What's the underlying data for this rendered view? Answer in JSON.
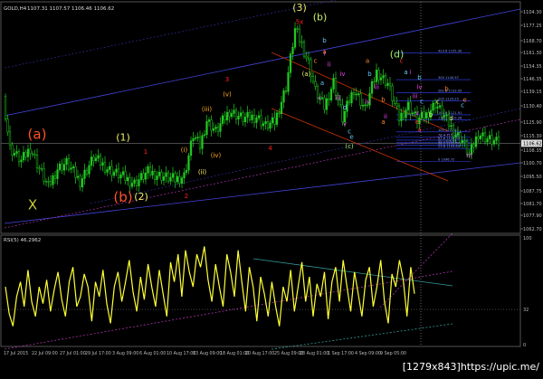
{
  "header": {
    "symbol": "GOLD,H4",
    "ohlc": "1107.31 1107.57 1106.46 1106.62",
    "rsi_title": "RSI(5) 46.2962"
  },
  "watermark": "[1279x843]https://upic.me/",
  "colors": {
    "background": "#000000",
    "axis": "#bbbbbb",
    "bull_candle": "#22cc22",
    "rsi_line": "#ffff33",
    "channel_blue": "#4444dd",
    "channel_red": "#cc3300",
    "dotted_magenta": "#aa33aa",
    "dotted_teal": "#339999"
  },
  "chart_data": [
    {
      "type": "candlestick",
      "title": "GOLD,H4",
      "y_ticks": [
        "1104.30",
        "1177.25",
        "1168.70",
        "1161.30",
        "1154.35",
        "1146.35",
        "1139.15",
        "1130.40",
        "1125.90",
        "1115.30",
        "1108.35",
        "1100.70",
        "1095.50",
        "1087.75",
        "1081.70",
        "1077.90",
        "1062.70"
      ],
      "x_ticks": [
        "17 Jul 2015",
        "22 Jul 09:00",
        "27 Jul 01:00",
        "29 Jul 17:00",
        "3 Aug 09:00",
        "6 Aug 01:00",
        "10 Aug 17:00",
        "13 Aug 09:00",
        "18 Aug 01:00",
        "20 Aug 17:00",
        "25 Aug 09:00",
        "28 Aug 01:00",
        "1 Sep 17:00",
        "4 Sep 09:00",
        "9 Sep 05:00"
      ],
      "price_label": "1106.62",
      "close_path": [
        {
          "x": 0,
          "y": 1132
        },
        {
          "x": 3,
          "y": 1104
        },
        {
          "x": 8,
          "y": 1097
        },
        {
          "x": 12,
          "y": 1104
        },
        {
          "x": 16,
          "y": 1093
        },
        {
          "x": 20,
          "y": 1083
        },
        {
          "x": 24,
          "y": 1093
        },
        {
          "x": 28,
          "y": 1096
        },
        {
          "x": 34,
          "y": 1086
        },
        {
          "x": 40,
          "y": 1099
        },
        {
          "x": 46,
          "y": 1093
        },
        {
          "x": 52,
          "y": 1089
        },
        {
          "x": 58,
          "y": 1085
        },
        {
          "x": 64,
          "y": 1091
        },
        {
          "x": 70,
          "y": 1089
        },
        {
          "x": 76,
          "y": 1087
        },
        {
          "x": 80,
          "y": 1089
        },
        {
          "x": 84,
          "y": 1111
        },
        {
          "x": 87,
          "y": 1105
        },
        {
          "x": 90,
          "y": 1119
        },
        {
          "x": 94,
          "y": 1113
        },
        {
          "x": 100,
          "y": 1124
        },
        {
          "x": 106,
          "y": 1120
        },
        {
          "x": 112,
          "y": 1121
        },
        {
          "x": 116,
          "y": 1116
        },
        {
          "x": 120,
          "y": 1118
        },
        {
          "x": 125,
          "y": 1137
        },
        {
          "x": 129,
          "y": 1168
        },
        {
          "x": 132,
          "y": 1160
        },
        {
          "x": 135,
          "y": 1150
        },
        {
          "x": 138,
          "y": 1135
        },
        {
          "x": 142,
          "y": 1126
        },
        {
          "x": 146,
          "y": 1140
        },
        {
          "x": 150,
          "y": 1120
        },
        {
          "x": 155,
          "y": 1136
        },
        {
          "x": 160,
          "y": 1125
        },
        {
          "x": 165,
          "y": 1145
        },
        {
          "x": 170,
          "y": 1139
        },
        {
          "x": 175,
          "y": 1120
        },
        {
          "x": 179,
          "y": 1127
        },
        {
          "x": 183,
          "y": 1119
        },
        {
          "x": 187,
          "y": 1122
        },
        {
          "x": 191,
          "y": 1128
        },
        {
          "x": 195,
          "y": 1121
        },
        {
          "x": 199,
          "y": 1113
        },
        {
          "x": 203,
          "y": 1108
        },
        {
          "x": 206,
          "y": 1100
        },
        {
          "x": 210,
          "y": 1112
        },
        {
          "x": 214,
          "y": 1109
        },
        {
          "x": 218,
          "y": 1107
        }
      ],
      "wave_labels": [
        {
          "text": "X",
          "color": "#cccc33",
          "x": 12,
          "y": 1071,
          "size": "large"
        },
        {
          "text": "(a)",
          "color": "#ff5522",
          "x": 14,
          "y": 1109,
          "size": "large"
        },
        {
          "text": "(1)",
          "color": "#eeee66",
          "x": 52,
          "y": 1108,
          "size": "medium"
        },
        {
          "text": "1",
          "color": "#ff2222",
          "x": 62,
          "y": 1101,
          "size": "small"
        },
        {
          "text": "(b)",
          "color": "#ff5522",
          "x": 52,
          "y": 1075,
          "size": "large"
        },
        {
          "text": "(2)",
          "color": "#eeee66",
          "x": 60,
          "y": 1076,
          "size": "medium"
        },
        {
          "text": "2",
          "color": "#ff2222",
          "x": 80,
          "y": 1077,
          "size": "small"
        },
        {
          "text": "(i)",
          "color": "#ffaa22",
          "x": 79,
          "y": 1102,
          "size": "small"
        },
        {
          "text": "(ii)",
          "color": "#ffee66",
          "x": 87,
          "y": 1090,
          "size": "small"
        },
        {
          "text": "(iii)",
          "color": "#ffaa22",
          "x": 89,
          "y": 1124,
          "size": "small"
        },
        {
          "text": "(iv)",
          "color": "#ffaa22",
          "x": 93,
          "y": 1099,
          "size": "small"
        },
        {
          "text": "(v)",
          "color": "#ffaa22",
          "x": 98,
          "y": 1132,
          "size": "small"
        },
        {
          "text": "3",
          "color": "#ff2222",
          "x": 98,
          "y": 1140,
          "size": "small"
        },
        {
          "text": "4",
          "color": "#ff2222",
          "x": 117,
          "y": 1103,
          "size": "small"
        },
        {
          "text": "(3)",
          "color": "#eeee66",
          "x": 130,
          "y": 1178,
          "size": "medium"
        },
        {
          "text": "5x",
          "color": "#ff2222",
          "x": 130,
          "y": 1171,
          "size": "small"
        },
        {
          "text": "(b)",
          "color": "#ccee66",
          "x": 139,
          "y": 1173,
          "size": "medium"
        },
        {
          "text": "b",
          "color": "#66ccff",
          "x": 141,
          "y": 1161,
          "size": "small"
        },
        {
          "text": "a",
          "color": "#ff8833",
          "x": 141,
          "y": 1155,
          "size": "small"
        },
        {
          "text": "i",
          "color": "#ee44ee",
          "x": 141,
          "y": 1154,
          "size": "small"
        },
        {
          "text": "c",
          "color": "#ff8833",
          "x": 137,
          "y": 1150,
          "size": "small"
        },
        {
          "text": "ii",
          "color": "#ee44ee",
          "x": 143,
          "y": 1148,
          "size": "small"
        },
        {
          "text": "(a)",
          "color": "#eeee66",
          "x": 133,
          "y": 1143,
          "size": "small"
        },
        {
          "text": "iv",
          "color": "#ee44ee",
          "x": 149,
          "y": 1143,
          "size": "small"
        },
        {
          "text": "a",
          "color": "#66ccff",
          "x": 140,
          "y": 1138,
          "size": "small"
        },
        {
          "text": "c",
          "color": "#ee44ee",
          "x": 139,
          "y": 1130,
          "size": "small"
        },
        {
          "text": "iii",
          "color": "#ee44ee",
          "x": 147,
          "y": 1130,
          "size": "small"
        },
        {
          "text": "d",
          "color": "#66ccff",
          "x": 150,
          "y": 1125,
          "size": "small"
        },
        {
          "text": "v",
          "color": "#ee44ee",
          "x": 150,
          "y": 1116,
          "size": "small"
        },
        {
          "text": "c",
          "color": "#66ccff",
          "x": 152,
          "y": 1112,
          "size": "small"
        },
        {
          "text": "e",
          "color": "#66ccff",
          "x": 153,
          "y": 1109,
          "size": "small"
        },
        {
          "text": "(c)",
          "color": "#99ee66",
          "x": 152,
          "y": 1104,
          "size": "small"
        },
        {
          "text": "a",
          "color": "#ff8833",
          "x": 160,
          "y": 1150,
          "size": "small"
        },
        {
          "text": "b",
          "color": "#66ccff",
          "x": 161,
          "y": 1143,
          "size": "small"
        },
        {
          "text": "iii",
          "color": "#ee44ee",
          "x": 164,
          "y": 1136,
          "size": "small"
        },
        {
          "text": "iv",
          "color": "#ee44ee",
          "x": 160,
          "y": 1128,
          "size": "small"
        },
        {
          "text": "b",
          "color": "#ff8833",
          "x": 167,
          "y": 1129,
          "size": "small"
        },
        {
          "text": "ii",
          "color": "#ee44ee",
          "x": 168,
          "y": 1120,
          "size": "small"
        },
        {
          "text": "a",
          "color": "#ff8833",
          "x": 167,
          "y": 1117,
          "size": "small"
        },
        {
          "text": "(d)",
          "color": "#99ee66",
          "x": 173,
          "y": 1153,
          "size": "medium"
        },
        {
          "text": "c",
          "color": "#ff3333",
          "x": 175,
          "y": 1150,
          "size": "small"
        },
        {
          "text": "a",
          "color": "#66ccff",
          "x": 177,
          "y": 1144,
          "size": "small"
        },
        {
          "text": "i",
          "color": "#ee44ee",
          "x": 179,
          "y": 1144,
          "size": "small"
        },
        {
          "text": "b",
          "color": "#66ccff",
          "x": 183,
          "y": 1141,
          "size": "small"
        },
        {
          "text": "iv",
          "color": "#ee44ee",
          "x": 183,
          "y": 1136,
          "size": "small"
        },
        {
          "text": "iii",
          "color": "#ee44ee",
          "x": 181,
          "y": 1131,
          "size": "small"
        },
        {
          "text": "c",
          "color": "#66ccff",
          "x": 184,
          "y": 1128,
          "size": "small"
        },
        {
          "text": "v",
          "color": "#ee44ee",
          "x": 182,
          "y": 1122,
          "size": "small"
        },
        {
          "text": "e",
          "color": "#ff3333",
          "x": 182,
          "y": 1117,
          "size": "small"
        },
        {
          "text": "a",
          "color": "#ff3333",
          "x": 183,
          "y": 1113,
          "size": "small"
        },
        {
          "text": "b",
          "color": "#ff8833",
          "x": 195,
          "y": 1135,
          "size": "small"
        },
        {
          "text": "c",
          "color": "#ccee66",
          "x": 191,
          "y": 1128,
          "size": "small"
        },
        {
          "text": "b",
          "color": "#ccee66",
          "x": 188,
          "y": 1121,
          "size": "small"
        },
        {
          "text": "d",
          "color": "#ccee66",
          "x": 197,
          "y": 1119,
          "size": "small"
        },
        {
          "text": "e",
          "color": "#ff8833",
          "x": 203,
          "y": 1129,
          "size": "small"
        },
        {
          "text": "c",
          "color": "#66ccff",
          "x": 202,
          "y": 1126,
          "size": "small"
        },
        {
          "text": "iii",
          "color": "#ee44ee",
          "x": 205,
          "y": 1099,
          "size": "small"
        }
      ],
      "fib_levels": [
        {
          "label": "423.6 1155.30",
          "y": 1155.3
        },
        {
          "label": "300 1140.97",
          "y": 1141.0
        },
        {
          "label": "261.8 1133.95",
          "y": 1134.0
        },
        {
          "label": "200 1129.25",
          "y": 1129.5
        },
        {
          "label": "161.8 1121.91",
          "y": 1122.0
        },
        {
          "label": "138.2 1119.26",
          "y": 1119.2
        },
        {
          "label": "100 1112.81",
          "y": 1112.8
        },
        {
          "label": "76.4 1109.95",
          "y": 1110.0
        },
        {
          "label": "61.8 1108.32",
          "y": 1108.3
        },
        {
          "label": "50 1106.93",
          "y": 1106.9
        },
        {
          "label": "38.2 1105.67",
          "y": 1105.7
        },
        {
          "label": "23.6 1103.84",
          "y": 1103.8
        },
        {
          "label": "0 1096.72",
          "y": 1096.7
        }
      ]
    },
    {
      "type": "line",
      "title": "RSI(5) 46.2962",
      "y_ticks": [
        "100",
        "32",
        "0"
      ],
      "ylim": [
        0,
        100
      ],
      "values": [
        55,
        28,
        15,
        45,
        60,
        35,
        72,
        40,
        25,
        55,
        38,
        62,
        30,
        52,
        70,
        42,
        25,
        60,
        75,
        35,
        45,
        68,
        55,
        20,
        60,
        45,
        72,
        38,
        18,
        55,
        70,
        40,
        60,
        82,
        50,
        30,
        65,
        42,
        78,
        55,
        35,
        72,
        48,
        25,
        80,
        60,
        88,
        45,
        92,
        70,
        55,
        88,
        75,
        96,
        62,
        40,
        78,
        55,
        35,
        88,
        70,
        45,
        92,
        60,
        30,
        75,
        55,
        20,
        65,
        48,
        25,
        60,
        35,
        15,
        55,
        40,
        72,
        30,
        55,
        80,
        40,
        65,
        25,
        58,
        45,
        70,
        22,
        60,
        75,
        40,
        82,
        55,
        30,
        70,
        48,
        25,
        62,
        75,
        35,
        55,
        82,
        40,
        18,
        68,
        55,
        82,
        62,
        25,
        75,
        48
      ]
    }
  ]
}
